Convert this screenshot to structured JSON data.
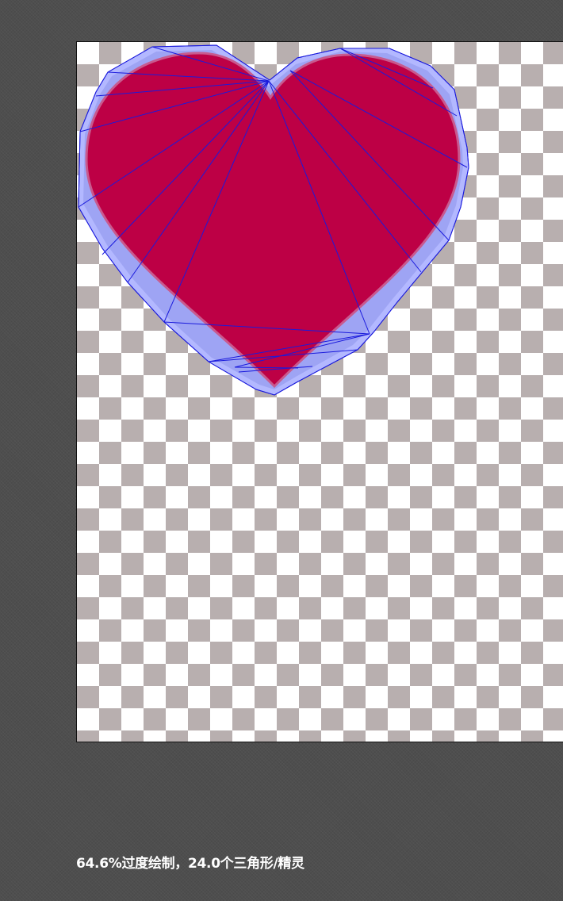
{
  "overlay": {
    "stats_text": "64.6%过度绘制，24.0个三角形/精灵"
  },
  "sprite": {
    "fill_color": "#bd0045",
    "mesh_fill_color": "#b3b8ff",
    "mesh_line_color": "#1a1adc",
    "icon": "heart-sprite"
  },
  "canvas": {
    "checker_color_a": "#ffffff",
    "checker_color_b": "#b8afaf",
    "background": "#4e4e4e"
  }
}
